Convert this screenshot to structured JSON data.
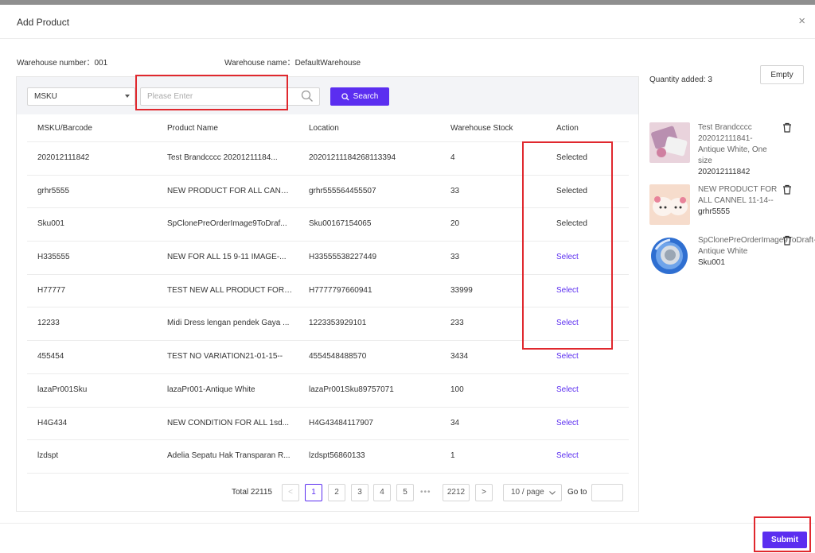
{
  "dialog": {
    "title": "Add Product",
    "close": "×"
  },
  "warehouse": {
    "number_label": "Warehouse number：",
    "number": "001",
    "name_label": "Warehouse name：",
    "name": "DefaultWarehouse"
  },
  "search": {
    "field": "MSKU",
    "placeholder": "Please Enter",
    "button": "Search",
    "search_icon": "search-icon"
  },
  "table": {
    "columns": [
      "MSKU/Barcode",
      "Product Name",
      "Location",
      "Warehouse Stock",
      "Action"
    ],
    "rows": [
      {
        "msku": "202012111842",
        "name": "Test Brandcccc 20201211184...",
        "location": "20201211184268113394",
        "stock": "4",
        "action": "Selected"
      },
      {
        "msku": "grhr5555",
        "name": "NEW PRODUCT FOR ALL CANN...",
        "location": "grhr555564455507",
        "stock": "33",
        "action": "Selected"
      },
      {
        "msku": "Sku001",
        "name": "SpClonePreOrderImage9ToDraf...",
        "location": "Sku00167154065",
        "stock": "20",
        "action": "Selected"
      },
      {
        "msku": "H335555",
        "name": "NEW FOR ALL 15 9-11 IMAGE-...",
        "location": "H33555538227449",
        "stock": "33",
        "action": "Select"
      },
      {
        "msku": "H77777",
        "name": "TEST NEW ALL PRODUCT FOR ...",
        "location": "H7777797660941",
        "stock": "33999",
        "action": "Select"
      },
      {
        "msku": "12233",
        "name": "Midi Dress lengan pendek Gaya ...",
        "location": "1223353929101",
        "stock": "233",
        "action": "Select"
      },
      {
        "msku": "455454",
        "name": "TEST NO VARIATION21-01-15--",
        "location": "4554548488570",
        "stock": "3434",
        "action": "Select"
      },
      {
        "msku": "lazaPr001Sku",
        "name": "lazaPr001-Antique White",
        "location": "lazaPr001Sku89757071",
        "stock": "100",
        "action": "Select"
      },
      {
        "msku": "H4G434",
        "name": "NEW CONDITION FOR ALL 1sd...",
        "location": "H4G43484117907",
        "stock": "34",
        "action": "Select"
      },
      {
        "msku": "lzdspt",
        "name": "Adelia Sepatu Hak Transparan R...",
        "location": "lzdspt56860133",
        "stock": "1",
        "action": "Select"
      }
    ]
  },
  "pagination": {
    "total": "Total 22115",
    "prev": "<",
    "pages": [
      "1",
      "2",
      "3",
      "4",
      "5"
    ],
    "ellipsis": "•••",
    "last": "2212",
    "next": ">",
    "page_size": "10 / page",
    "goto_label": "Go to"
  },
  "added": {
    "quantity_label": "Quantity added: 3",
    "empty_button": "Empty",
    "items": [
      {
        "name": "Test Brandcccc 202012111841-Antique White, One size",
        "sku": "202012111842"
      },
      {
        "name": "NEW PRODUCT FOR ALL CANNEL 11-14--",
        "sku": "grhr5555"
      },
      {
        "name": "SpClonePreOrderImage9ToDraft-Antique White",
        "sku": "Sku001"
      }
    ]
  },
  "footer": {
    "submit": "Submit"
  },
  "colors": {
    "accent": "#5b2ef0",
    "highlight": "#e0282e"
  }
}
